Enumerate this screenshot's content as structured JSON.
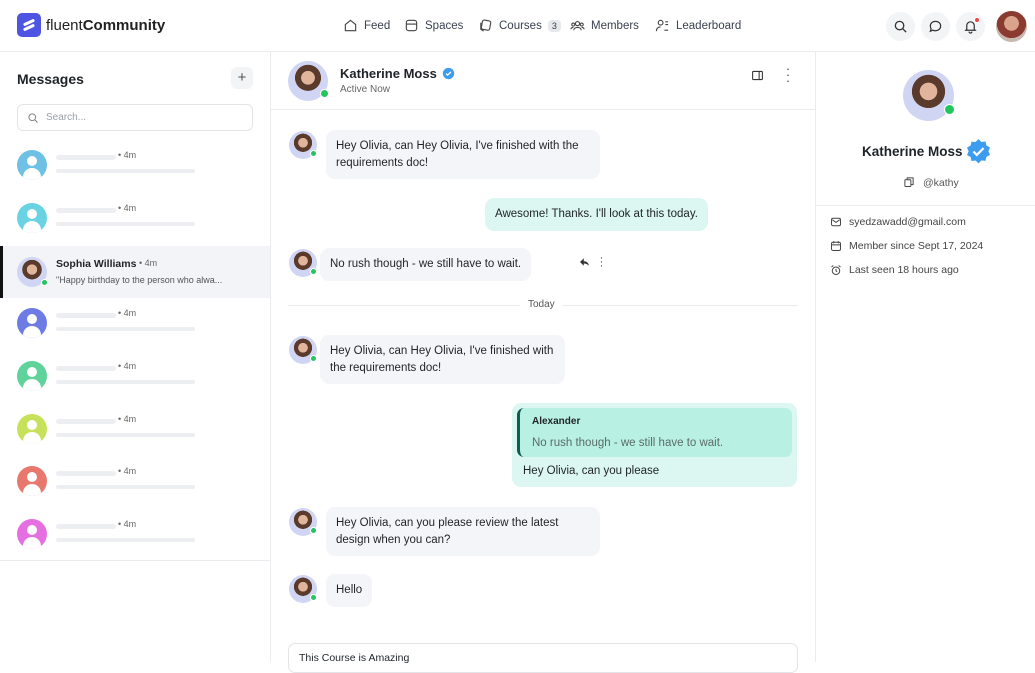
{
  "header": {
    "brand_light": "fluent",
    "brand_bold": "Community",
    "nav": [
      {
        "label": "Feed",
        "icon": "home-icon"
      },
      {
        "label": "Spaces",
        "icon": "spaces-icon"
      },
      {
        "label": "Courses",
        "icon": "courses-icon",
        "badge": "3"
      },
      {
        "label": "Members",
        "icon": "members-icon"
      },
      {
        "label": "Leaderboard",
        "icon": "leaderboard-icon"
      }
    ]
  },
  "sidebar": {
    "title": "Messages",
    "add": "+",
    "search_placeholder": "Search...",
    "items": [
      {
        "time": "4m",
        "color": "#6ec1e4"
      },
      {
        "time": "4m",
        "color": "#6ad3e3"
      },
      {
        "name": "Sophia Williams",
        "time": "4m",
        "preview": "\"Happy birthday to the person who alwa...",
        "active": true
      },
      {
        "time": "4m",
        "color": "#6d7ce4"
      },
      {
        "time": "4m",
        "color": "#5fd39a"
      },
      {
        "time": "4m",
        "color": "#c7e25a"
      },
      {
        "time": "4m",
        "color": "#e8776e"
      },
      {
        "time": "4m",
        "color": "#e56fe0"
      }
    ]
  },
  "chat": {
    "name": "Katherine Moss",
    "status": "Active Now",
    "messages": [
      {
        "text": "Hey Olivia, can Hey Olivia, I've finished with the requirements doc!"
      },
      {
        "text": "Awesome! Thanks. I'll look at this today.",
        "sent": true
      },
      {
        "text": "No rush though - we still have to wait."
      },
      {
        "text": "Hey Olivia, can Hey Olivia, I've finished with the requirements doc!"
      },
      {
        "reply_author": "Alexander",
        "reply_text": "No rush though - we still have to wait.",
        "text": "Hey Olivia, can you please",
        "sent": true
      },
      {
        "text": "Hey Olivia, can you please review the latest design when you can?"
      },
      {
        "text": "Hello"
      }
    ],
    "divider": "Today",
    "input_value": "This Course is Amazing"
  },
  "profile": {
    "name": "Katherine Moss",
    "handle": "@kathy",
    "email": "syedzawadd@gmail.com",
    "member_since": "Member since Sept 17, 2024",
    "last_seen": "Last seen 18 hours ago"
  },
  "colors": {
    "accent": "#4f55e3",
    "sent_bubble": "#dcf7f1",
    "online": "#22c55e",
    "verified": "#3b9cf0"
  }
}
